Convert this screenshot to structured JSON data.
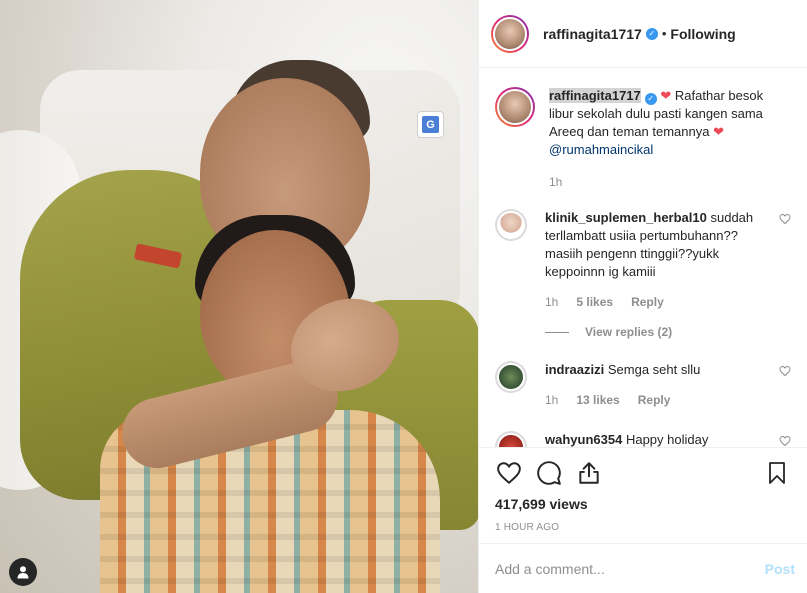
{
  "post": {
    "author": "raffinagita1717",
    "follow_state": "Following",
    "separator": "•",
    "caption_text": "Rafathar besok libur sekolah dulu pasti kangen sama Areeq dan teman temannya",
    "caption_mention": "@rumahmaincikal",
    "caption_time": "1h",
    "views": "417,699 views",
    "posted_ago": "1 HOUR AGO"
  },
  "comments": [
    {
      "username": "klinik_suplemen_herbal10",
      "text": "suddah terllambatt usiia pertumbuhann?? masiih pengenn ttinggii??yukk keppoinnn ig kamiii",
      "time": "1h",
      "likes": "5 likes",
      "reply_label": "Reply",
      "view_replies": "View replies (2)"
    },
    {
      "username": "indraazizi",
      "text": "Semga seht sllu",
      "time": "1h",
      "likes": "13 likes",
      "reply_label": "Reply"
    },
    {
      "username": "wahyun6354",
      "text": "Happy holiday"
    }
  ],
  "composer": {
    "placeholder": "Add a comment...",
    "post_label": "Post"
  },
  "icons": {
    "verified": "verified-badge-icon",
    "heart": "heart-icon",
    "comment": "comment-icon",
    "share": "share-icon",
    "save": "bookmark-icon",
    "translate": "translate-icon",
    "user_tag": "user-tag-icon"
  },
  "colors": {
    "verified_blue": "#3897f0",
    "post_button_disabled": "#b2dffc",
    "secondary_text": "#8e8e8e",
    "mention": "#003569",
    "heart_red": "#ed4956"
  }
}
